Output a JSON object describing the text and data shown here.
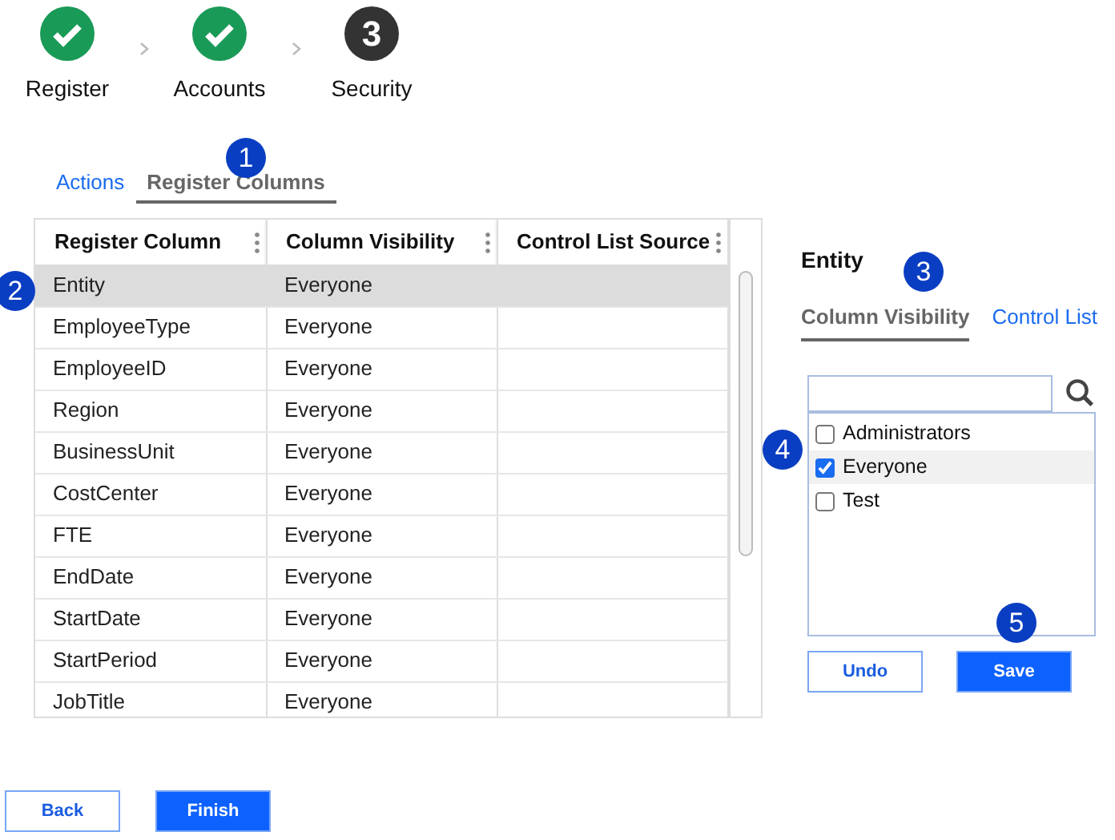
{
  "steps": [
    {
      "label": "Register",
      "completed": true
    },
    {
      "label": "Accounts",
      "completed": true
    },
    {
      "label": "Security",
      "completed": false,
      "number": "3"
    }
  ],
  "register_tabs": {
    "callout": "1",
    "items": [
      {
        "label": "Actions",
        "selected": false
      },
      {
        "label": "Register Columns",
        "selected": true
      }
    ]
  },
  "grid": {
    "callout": "2",
    "columns": [
      "Register Column",
      "Column Visibility",
      "Control List Source"
    ],
    "rows": [
      {
        "register_column": "Entity",
        "column_visibility": "Everyone",
        "selected": true
      },
      {
        "register_column": "EmployeeType",
        "column_visibility": "Everyone",
        "selected": false
      },
      {
        "register_column": "EmployeeID",
        "column_visibility": "Everyone",
        "selected": false
      },
      {
        "register_column": "Region",
        "column_visibility": "Everyone",
        "selected": false
      },
      {
        "register_column": "BusinessUnit",
        "column_visibility": "Everyone",
        "selected": false
      },
      {
        "register_column": "CostCenter",
        "column_visibility": "Everyone",
        "selected": false
      },
      {
        "register_column": "FTE",
        "column_visibility": "Everyone",
        "selected": false
      },
      {
        "register_column": "EndDate",
        "column_visibility": "Everyone",
        "selected": false
      },
      {
        "register_column": "StartDate",
        "column_visibility": "Everyone",
        "selected": false
      },
      {
        "register_column": "StartPeriod",
        "column_visibility": "Everyone",
        "selected": false
      },
      {
        "register_column": "JobTitle",
        "column_visibility": "Everyone",
        "selected": false
      }
    ]
  },
  "detail": {
    "title": "Entity",
    "tabs": {
      "callout": "3",
      "items": [
        {
          "label": "Column Visibility",
          "selected": true
        },
        {
          "label": "Control List",
          "selected": false
        }
      ]
    },
    "groups": {
      "callout": "4",
      "items": [
        {
          "label": "Administrators",
          "checked": false,
          "selected": false
        },
        {
          "label": "Everyone",
          "checked": true,
          "selected": true
        },
        {
          "label": "Test",
          "checked": false,
          "selected": false
        }
      ]
    },
    "buttons": {
      "callout": "5",
      "items": [
        {
          "label": "Undo",
          "kind": "outline"
        },
        {
          "label": "Save",
          "kind": "primary"
        }
      ]
    }
  },
  "footer_buttons": [
    {
      "label": "Back",
      "kind": "outline"
    },
    {
      "label": "Finish",
      "kind": "primary"
    }
  ]
}
